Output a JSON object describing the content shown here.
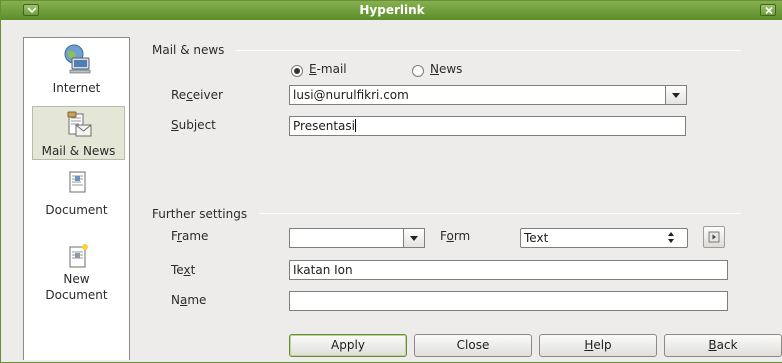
{
  "window": {
    "title": "Hyperlink"
  },
  "sidebar": {
    "items": [
      {
        "label": "Internet",
        "icon": "globe-computer-icon"
      },
      {
        "label": "Mail & News",
        "icon": "mail-news-icon",
        "selected": true
      },
      {
        "label": "Document",
        "icon": "document-icon"
      },
      {
        "label_line1": "New",
        "label_line2": "Document",
        "icon": "new-document-icon"
      }
    ]
  },
  "mail_news": {
    "group_title": "Mail & news",
    "email_radio": {
      "pre": "",
      "mnemonic": "E",
      "post": "-mail",
      "checked": true
    },
    "news_radio": {
      "pre": "",
      "mnemonic": "N",
      "post": "ews",
      "checked": false
    },
    "receiver": {
      "label_pre": "Re",
      "label_mnemonic": "c",
      "label_post": "eiver",
      "value": "lusi@nurulfikri.com"
    },
    "subject": {
      "label_pre": "",
      "label_mnemonic": "S",
      "label_post": "ubject",
      "value": "Presentasi"
    }
  },
  "further": {
    "group_title": "Further settings",
    "frame": {
      "label_pre": "F",
      "label_mnemonic": "r",
      "label_post": "ame",
      "value": ""
    },
    "form": {
      "label_pre": "F",
      "label_mnemonic": "o",
      "label_post": "rm",
      "value": "Text"
    },
    "text": {
      "label_pre": "Te",
      "label_mnemonic": "x",
      "label_post": "t",
      "value": "Ikatan Ion"
    },
    "name": {
      "label_pre": "N",
      "label_mnemonic": "a",
      "label_post": "me",
      "value": ""
    }
  },
  "buttons": {
    "apply": "Apply",
    "close": "Close",
    "help_mnemonic": "H",
    "help_rest": "elp",
    "back_mnemonic": "B",
    "back_rest": "ack"
  }
}
